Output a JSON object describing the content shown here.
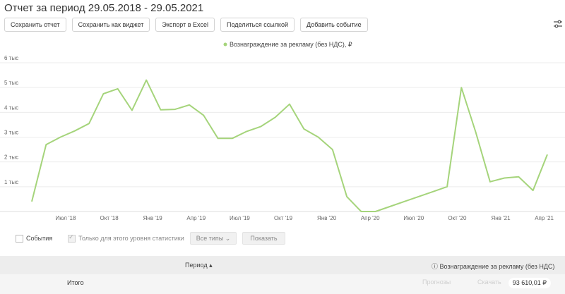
{
  "page_title": "Отчет за период 29.05.2018 - 29.05.2021",
  "toolbar": {
    "save_report": "Сохранить отчет",
    "save_widget": "Сохранить как виджет",
    "export_excel": "Экспорт в Excel",
    "share_link": "Поделиться ссылкой",
    "add_event": "Добавить событие"
  },
  "icons": {
    "settings": "sliders-icon"
  },
  "chart_data": {
    "type": "line",
    "legend": [
      "Вознаграждение за рекламу (без НДС), ₽"
    ],
    "y_ticks": [
      "1 тыс",
      "2 тыс",
      "3 тыс",
      "4 тыс",
      "5 тыс",
      "6 тыс"
    ],
    "x_ticks": [
      "Июл '18",
      "Окт '18",
      "Янв '19",
      "Апр '19",
      "Июл '19",
      "Окт '19",
      "Янв '20",
      "Апр '20",
      "Июл '20",
      "Окт '20",
      "Янв '21",
      "Апр '21"
    ],
    "ylim": [
      0,
      6000
    ],
    "color": "#a5d47b",
    "series": [
      {
        "name": "Вознаграждение за рекламу (без НДС), ₽",
        "values": [
          400,
          2700,
          3000,
          3250,
          3550,
          4750,
          4950,
          4080,
          5300,
          4100,
          4120,
          4300,
          3880,
          2950,
          2950,
          3230,
          3430,
          3800,
          4330,
          3330,
          3000,
          2500,
          600,
          0,
          0,
          200,
          400,
          600,
          800,
          1000,
          5000,
          3200,
          1200,
          1350,
          1400,
          850,
          2300
        ]
      }
    ]
  },
  "controls": {
    "events_label": "События",
    "only_level_label": "Только для этого уровня статистики",
    "all_types": "Все типы",
    "show_button": "Показать"
  },
  "table": {
    "col_period": "Период",
    "col_reward": "Вознаграждение за рекламу (без НДС)",
    "total_label": "Итого",
    "total_value": "93 610,01 ₽",
    "ghost_a": "Прогнозы",
    "ghost_b": "Скачать"
  }
}
